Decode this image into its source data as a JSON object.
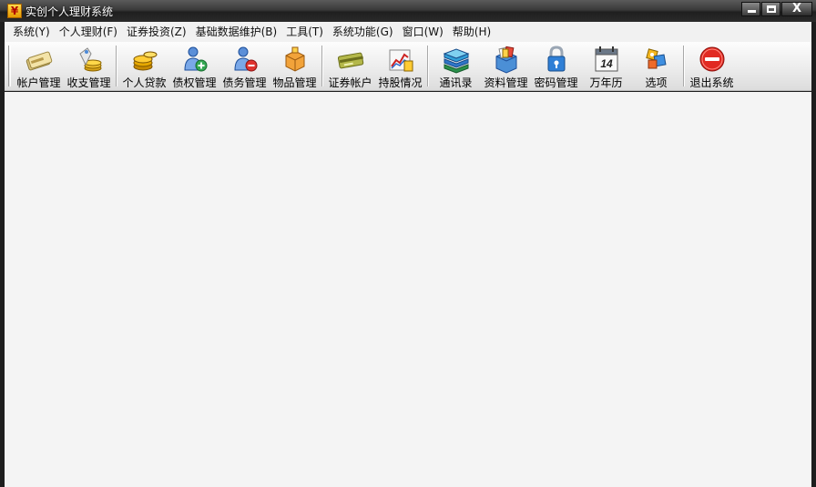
{
  "window": {
    "title": "实创个人理财系统",
    "app_icon_glyph": "¥",
    "controls": {
      "close_glyph": "X"
    }
  },
  "menu": [
    {
      "label": "系统(Y)"
    },
    {
      "label": "个人理财(F)"
    },
    {
      "label": "证券投资(Z)"
    },
    {
      "label": "基础数据维护(B)"
    },
    {
      "label": "工具(T)"
    },
    {
      "label": "系统功能(G)"
    },
    {
      "label": "窗口(W)"
    },
    {
      "label": "帮助(H)"
    }
  ],
  "toolbar": {
    "groups": [
      [
        {
          "label": "帐户管理",
          "icon": "account-card-icon"
        },
        {
          "label": "收支管理",
          "icon": "income-expense-icon"
        }
      ],
      [
        {
          "label": "个人贷款",
          "icon": "coins-icon"
        },
        {
          "label": "债权管理",
          "icon": "user-add-icon"
        },
        {
          "label": "债务管理",
          "icon": "user-remove-icon"
        },
        {
          "label": "物品管理",
          "icon": "box-icon"
        }
      ],
      [
        {
          "label": "证券帐户",
          "icon": "securities-card-icon"
        },
        {
          "label": "持股情况",
          "icon": "stock-chart-icon"
        }
      ],
      [
        {
          "label": "通讯录",
          "icon": "address-book-icon"
        },
        {
          "label": "资料管理",
          "icon": "document-box-icon"
        },
        {
          "label": "密码管理",
          "icon": "lock-icon"
        },
        {
          "label": "万年历",
          "icon": "calendar-icon",
          "day": "14"
        },
        {
          "label": "选项",
          "icon": "options-icon"
        }
      ],
      [
        {
          "label": "退出系统",
          "icon": "exit-icon"
        }
      ]
    ]
  },
  "colors": {
    "titlebar": "#2a2a2a",
    "menubar": "#f1f1f1",
    "client": "#f4f4f4"
  }
}
